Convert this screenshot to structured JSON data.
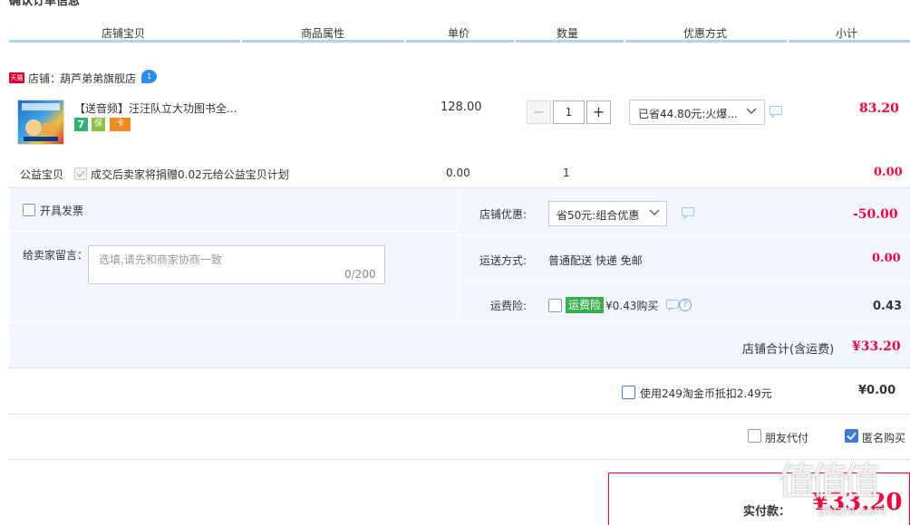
{
  "section_title": "确认订单信息",
  "columns": [
    "店铺宝贝",
    "商品属性",
    "单价",
    "数量",
    "优惠方式",
    "小计"
  ],
  "shop": {
    "badge": "天猫",
    "label": "店铺：",
    "name": "葫芦弟弟旗舰店",
    "wangwang_badge": "1"
  },
  "item": {
    "title": "【送音频】汪汪队立大功图书全...",
    "service_badges": [
      "7",
      "保",
      "卡"
    ],
    "price": "128.00",
    "qty": "1",
    "qty_minus": "−",
    "qty_plus": "+",
    "promo": "已省44.80元:火爆...",
    "subtotal": "83.20"
  },
  "charity": {
    "label": "公益宝贝",
    "text": "成交后卖家将捐赠0.02元给公益宝贝计划",
    "price": "0.00",
    "qty": "1",
    "subtotal": "0.00"
  },
  "invoice": {
    "label": "开具发票"
  },
  "message": {
    "label": "给卖家留言：",
    "placeholder": "选填,请先和商家协商一致",
    "counter": "0/200"
  },
  "shop_discount": {
    "label": "店铺优惠:",
    "option": "省50元:组合优惠",
    "amount": "-50.00"
  },
  "shipping": {
    "label": "运送方式:",
    "text": "普通配送 快递 免邮",
    "amount": "0.00"
  },
  "insurance": {
    "label": "运费险:",
    "tag": "运费险",
    "text": "¥0.43购买",
    "amount": "0.43"
  },
  "shop_total": {
    "label": "店铺合计(含运费)",
    "amount": "¥33.20"
  },
  "coin": {
    "text": "使用249淘金币抵扣2.49元",
    "amount": "¥0.00"
  },
  "options": {
    "friend_pay": "朋友代付",
    "anonymous": "匿名购买"
  },
  "final": {
    "label": "实付款：",
    "amount": "¥33.20"
  },
  "watermark": {
    "text": "值",
    "site": "zhizhi.com"
  },
  "colors": {
    "accent_red": "#ff0036",
    "header_line": "#b2d1ff",
    "panel_bg": "#f2f7ff",
    "check_blue": "#3a7bd5",
    "insurance_green": "#39ae4c"
  }
}
